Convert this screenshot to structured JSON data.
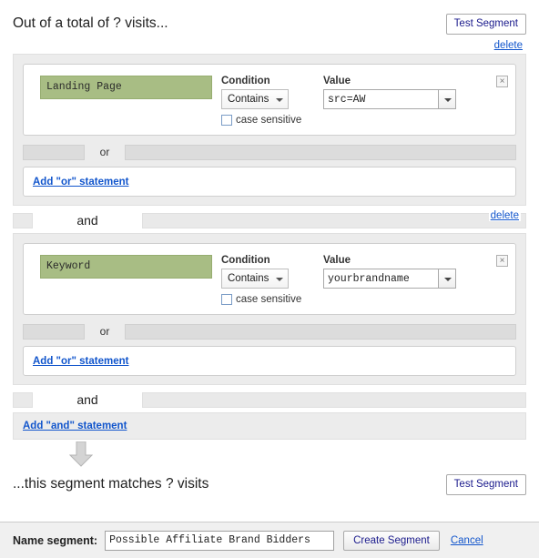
{
  "header": {
    "title": "Out of a total of ? visits...",
    "test_segment_label": "Test Segment"
  },
  "labels": {
    "delete": "delete",
    "condition": "Condition",
    "value": "Value",
    "case_sensitive": "case sensitive",
    "or": "or",
    "and": "and",
    "add_or_statement": "Add \"or\" statement",
    "add_and_statement": "Add \"and\" statement",
    "remove_icon": "×"
  },
  "blocks": [
    {
      "dimension": "Landing Page",
      "condition": "Contains",
      "value": "src=AW",
      "case_sensitive_checked": false,
      "delete_label": "delete"
    },
    {
      "dimension": "Keyword",
      "condition": "Contains",
      "value": "yourbrandname",
      "case_sensitive_checked": false,
      "delete_label": "delete"
    }
  ],
  "footer": {
    "match_text": "...this segment matches ? visits",
    "test_segment_label": "Test Segment",
    "name_label": "Name segment:",
    "name_value": "Possible Affiliate Brand Bidders",
    "name_placeholder": "Name segment",
    "create_label": "Create Segment",
    "cancel_label": "Cancel"
  },
  "colors": {
    "dimension_green": "#a8bd84",
    "link_blue": "#1155cc",
    "panel_gray": "#ececec"
  }
}
